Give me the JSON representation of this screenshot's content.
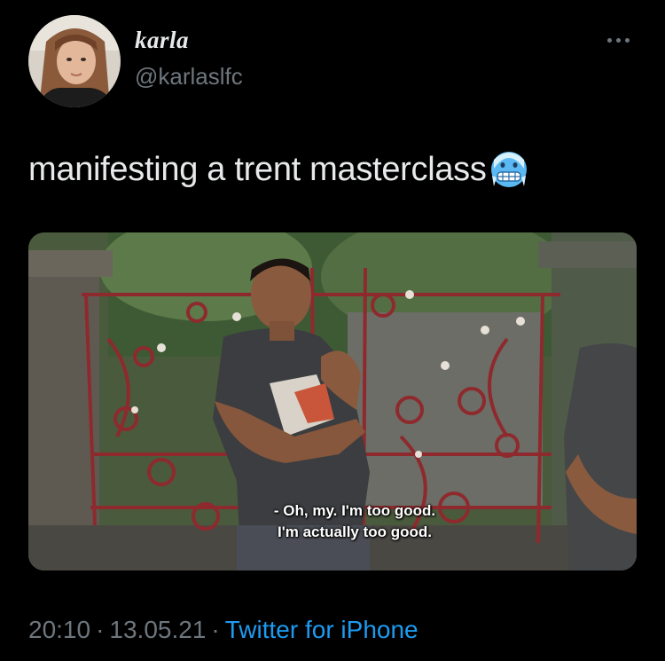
{
  "user": {
    "display_name": "karla",
    "handle": "@karlaslfc",
    "avatar_icon": "profile-photo"
  },
  "tweet": {
    "text": "manifesting a trent masterclass",
    "emoji": "cold-face-emoji"
  },
  "media": {
    "subtitle_line_1": "- Oh, my. I'm too good.",
    "subtitle_line_2": "I'm actually too good."
  },
  "meta": {
    "time": "20:10",
    "date": "13.05.21",
    "separator": "·",
    "source": "Twitter for iPhone"
  },
  "colors": {
    "background": "#000000",
    "text": "#e7e9ea",
    "secondary": "#6e767d",
    "link": "#1d9bf0"
  }
}
